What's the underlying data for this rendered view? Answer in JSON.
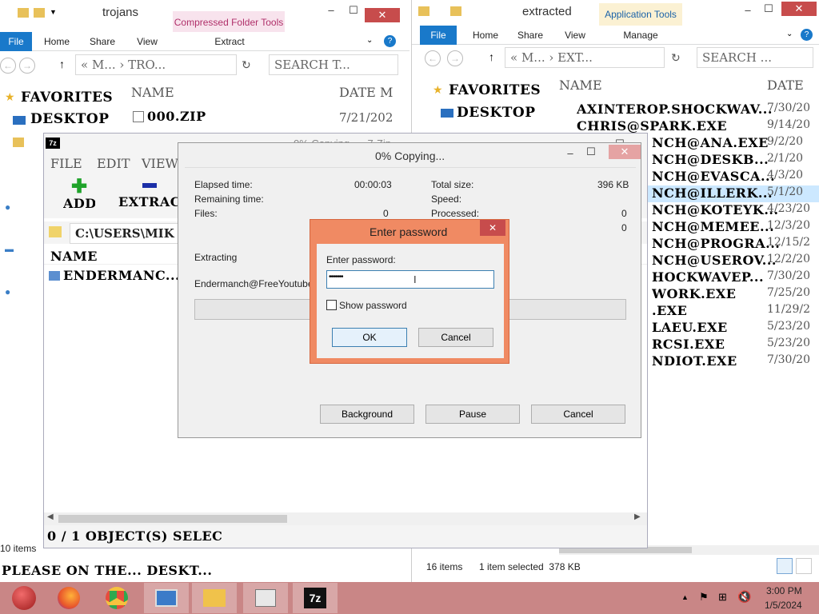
{
  "left_explorer": {
    "title": "trojans",
    "context_tab": "Compressed Folder Tools",
    "tabs": [
      "File",
      "Home",
      "Share",
      "View",
      "Extract"
    ],
    "address": "« M... › TRO...",
    "search_placeholder": "SEARCH T...",
    "favorites_label": "FAVORITES",
    "desktop_label": "DESKTOP",
    "col_name": "NAME",
    "col_date": "DATE M",
    "files": [
      {
        "name": "000.ZIP",
        "date": "7/21/202"
      }
    ],
    "status_items": "10 items"
  },
  "right_explorer": {
    "title": "extracted",
    "context_tab": "Application Tools",
    "tabs": [
      "File",
      "Home",
      "Share",
      "View",
      "Manage"
    ],
    "address": "« M... › EXT...",
    "search_placeholder": "SEARCH ...",
    "favorites_label": "FAVORITES",
    "desktop_label": "DESKTOP",
    "col_name": "NAME",
    "col_date": "DATE",
    "files": [
      {
        "name": "AXINTEROP.SHOCKWAV...",
        "date": "7/30/20"
      },
      {
        "name": "CHRIS@SPARK.EXE",
        "date": "9/14/20"
      },
      {
        "name": "NCH@ANA.EXE",
        "date": "9/2/20"
      },
      {
        "name": "NCH@DESKB...",
        "date": "2/1/20"
      },
      {
        "name": "NCH@EVASCA...",
        "date": "4/3/20"
      },
      {
        "name": "NCH@ILLERK...",
        "date": "5/1/20"
      },
      {
        "name": "NCH@KOTEYK...",
        "date": "4/23/20"
      },
      {
        "name": "NCH@MEMEE...",
        "date": "12/3/20"
      },
      {
        "name": "NCH@PROGRA...",
        "date": "12/15/2"
      },
      {
        "name": "NCH@USEROV...",
        "date": "12/2/20"
      },
      {
        "name": "HOCKWAVEP...",
        "date": "7/30/20"
      },
      {
        "name": "WORK.EXE",
        "date": "7/25/20"
      },
      {
        "name": ".EXE",
        "date": "11/29/2"
      },
      {
        "name": "LAEU.EXE",
        "date": "5/23/20"
      },
      {
        "name": "RCSI.EXE",
        "date": "5/23/20"
      },
      {
        "name": "NDIOT.EXE",
        "date": "7/30/20"
      }
    ],
    "status_items": "16 items",
    "status_selected": "1 item selected  378 KB"
  },
  "sevenzip_main": {
    "title": "0% Copying... - 7-Zip",
    "menu": [
      "FILE",
      "EDIT",
      "VIEW"
    ],
    "add_label": "ADD",
    "extract_label": "EXTRAC",
    "path": "C:\\USERS\\MIK",
    "col_name": "NAME",
    "item": "ENDERMANC...",
    "status": "0 / 1 OBJECT(S) SELEC"
  },
  "copy_dialog": {
    "title": "0% Copying...",
    "elapsed_label": "Elapsed time:",
    "elapsed_value": "00:00:03",
    "remaining_label": "Remaining time:",
    "files_label": "Files:",
    "files_value": "0",
    "total_size_label": "Total size:",
    "total_size_value": "396 KB",
    "speed_label": "Speed:",
    "processed_label": "Processed:",
    "processed_value": "0",
    "extra_value": "0",
    "extracting_label": "Extracting",
    "current_file": "Endermanch@FreeYoutubeDo",
    "background_btn": "Background",
    "pause_btn": "Pause",
    "cancel_btn": "Cancel"
  },
  "password_dialog": {
    "title": "Enter password",
    "prompt": "Enter password:",
    "value": "•••••••",
    "show_password": "Show password",
    "ok": "OK",
    "cancel": "Cancel"
  },
  "desktop_overlay_text": "PLEASE ON THE... DESKT...",
  "taskbar": {
    "time": "3:00 PM",
    "date": "1/5/2024",
    "apps": [
      "start-orb",
      "firefox",
      "chrome",
      "remote-desktop",
      "file-explorer",
      "task-manager",
      "7zip"
    ]
  },
  "colors": {
    "taskbar": "#c98686",
    "file_tab": "#1979ca",
    "dialog_frame": "#f08a63",
    "close_button": "#c74c4c"
  }
}
